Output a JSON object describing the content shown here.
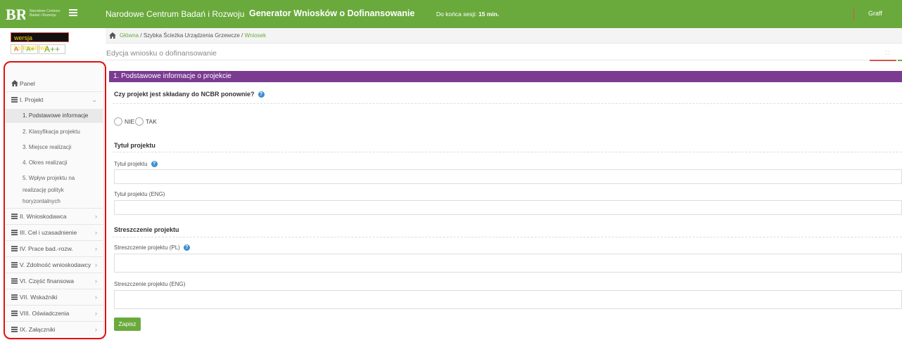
{
  "header": {
    "logo_text_1": "Narodowe Centrum",
    "logo_text_2": "Badań i Rozwoju",
    "org_name": "Narodowe Centrum Badań i Rozwoju",
    "app_title": "Generator Wniosków o Dofinansowanie",
    "session_label": "Do końca sesji:",
    "session_time": "15 min.",
    "user": "Graff"
  },
  "accessibility": {
    "contrast_label": "wersja kontrastowa",
    "font_small": "A",
    "font_medium": "A+",
    "font_large": "A++"
  },
  "breadcrumb": {
    "home": "Główna",
    "sep": "/",
    "item2": "Szybka Ścieżka Urządzenia Grzewcze",
    "item3": "Wniosek"
  },
  "page": {
    "title": "Edycja wniosku o dofinansowanie"
  },
  "sidebar": {
    "panel": "Panel",
    "items": [
      {
        "label": "I. Projekt",
        "chevron": "⌄"
      },
      {
        "label": "II. Wnioskodawca",
        "chevron": "›"
      },
      {
        "label": "III. Cel i uzasadnienie",
        "chevron": "›"
      },
      {
        "label": "IV. Prace bad.-rozw.",
        "chevron": "›"
      },
      {
        "label": "V. Zdolność wnioskodawcy",
        "chevron": "›"
      },
      {
        "label": "VI. Część finansowa",
        "chevron": "›"
      },
      {
        "label": "VII. Wskaźniki",
        "chevron": "›"
      },
      {
        "label": "VIII. Oświadczenia",
        "chevron": "›"
      },
      {
        "label": "IX. Załączniki",
        "chevron": "›"
      }
    ],
    "subitems": [
      "1. Podstawowe informacje",
      "2. Klasyfikacja projektu",
      "3. Miejsce realizacji",
      "4. Okres realizacji",
      "5. Wpływ projektu na realizację polityk horyzontalnych"
    ]
  },
  "form": {
    "panel_title": "1. Podstawowe informacje o projekcie",
    "question": "Czy projekt jest składany do NCBR ponownie?",
    "radio_no": "NIE",
    "radio_yes": "TAK",
    "section_title": "Tytuł projektu",
    "label_title": "Tytuł projektu",
    "label_title_eng": "Tytuł projektu (ENG)",
    "section_summary": "Streszczenie projektu",
    "label_summary_pl": "Streszczenie projektu (PL)",
    "label_summary_eng": "Streszczenie projektu (ENG)",
    "title_value": "",
    "title_eng_value": "",
    "summary_pl_value": "",
    "summary_eng_value": "",
    "save_label": "Zapisz",
    "help_glyph": "?"
  }
}
